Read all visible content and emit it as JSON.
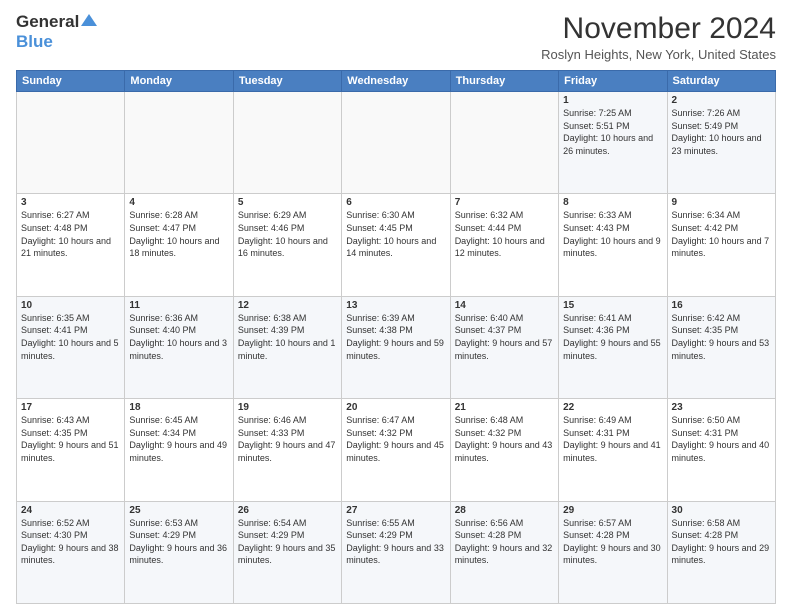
{
  "logo": {
    "general": "General",
    "blue": "Blue"
  },
  "title": "November 2024",
  "location": "Roslyn Heights, New York, United States",
  "weekdays": [
    "Sunday",
    "Monday",
    "Tuesday",
    "Wednesday",
    "Thursday",
    "Friday",
    "Saturday"
  ],
  "weeks": [
    [
      {
        "day": "",
        "info": ""
      },
      {
        "day": "",
        "info": ""
      },
      {
        "day": "",
        "info": ""
      },
      {
        "day": "",
        "info": ""
      },
      {
        "day": "",
        "info": ""
      },
      {
        "day": "1",
        "info": "Sunrise: 7:25 AM\nSunset: 5:51 PM\nDaylight: 10 hours and 26 minutes."
      },
      {
        "day": "2",
        "info": "Sunrise: 7:26 AM\nSunset: 5:49 PM\nDaylight: 10 hours and 23 minutes."
      }
    ],
    [
      {
        "day": "3",
        "info": "Sunrise: 6:27 AM\nSunset: 4:48 PM\nDaylight: 10 hours and 21 minutes."
      },
      {
        "day": "4",
        "info": "Sunrise: 6:28 AM\nSunset: 4:47 PM\nDaylight: 10 hours and 18 minutes."
      },
      {
        "day": "5",
        "info": "Sunrise: 6:29 AM\nSunset: 4:46 PM\nDaylight: 10 hours and 16 minutes."
      },
      {
        "day": "6",
        "info": "Sunrise: 6:30 AM\nSunset: 4:45 PM\nDaylight: 10 hours and 14 minutes."
      },
      {
        "day": "7",
        "info": "Sunrise: 6:32 AM\nSunset: 4:44 PM\nDaylight: 10 hours and 12 minutes."
      },
      {
        "day": "8",
        "info": "Sunrise: 6:33 AM\nSunset: 4:43 PM\nDaylight: 10 hours and 9 minutes."
      },
      {
        "day": "9",
        "info": "Sunrise: 6:34 AM\nSunset: 4:42 PM\nDaylight: 10 hours and 7 minutes."
      }
    ],
    [
      {
        "day": "10",
        "info": "Sunrise: 6:35 AM\nSunset: 4:41 PM\nDaylight: 10 hours and 5 minutes."
      },
      {
        "day": "11",
        "info": "Sunrise: 6:36 AM\nSunset: 4:40 PM\nDaylight: 10 hours and 3 minutes."
      },
      {
        "day": "12",
        "info": "Sunrise: 6:38 AM\nSunset: 4:39 PM\nDaylight: 10 hours and 1 minute."
      },
      {
        "day": "13",
        "info": "Sunrise: 6:39 AM\nSunset: 4:38 PM\nDaylight: 9 hours and 59 minutes."
      },
      {
        "day": "14",
        "info": "Sunrise: 6:40 AM\nSunset: 4:37 PM\nDaylight: 9 hours and 57 minutes."
      },
      {
        "day": "15",
        "info": "Sunrise: 6:41 AM\nSunset: 4:36 PM\nDaylight: 9 hours and 55 minutes."
      },
      {
        "day": "16",
        "info": "Sunrise: 6:42 AM\nSunset: 4:35 PM\nDaylight: 9 hours and 53 minutes."
      }
    ],
    [
      {
        "day": "17",
        "info": "Sunrise: 6:43 AM\nSunset: 4:35 PM\nDaylight: 9 hours and 51 minutes."
      },
      {
        "day": "18",
        "info": "Sunrise: 6:45 AM\nSunset: 4:34 PM\nDaylight: 9 hours and 49 minutes."
      },
      {
        "day": "19",
        "info": "Sunrise: 6:46 AM\nSunset: 4:33 PM\nDaylight: 9 hours and 47 minutes."
      },
      {
        "day": "20",
        "info": "Sunrise: 6:47 AM\nSunset: 4:32 PM\nDaylight: 9 hours and 45 minutes."
      },
      {
        "day": "21",
        "info": "Sunrise: 6:48 AM\nSunset: 4:32 PM\nDaylight: 9 hours and 43 minutes."
      },
      {
        "day": "22",
        "info": "Sunrise: 6:49 AM\nSunset: 4:31 PM\nDaylight: 9 hours and 41 minutes."
      },
      {
        "day": "23",
        "info": "Sunrise: 6:50 AM\nSunset: 4:31 PM\nDaylight: 9 hours and 40 minutes."
      }
    ],
    [
      {
        "day": "24",
        "info": "Sunrise: 6:52 AM\nSunset: 4:30 PM\nDaylight: 9 hours and 38 minutes."
      },
      {
        "day": "25",
        "info": "Sunrise: 6:53 AM\nSunset: 4:29 PM\nDaylight: 9 hours and 36 minutes."
      },
      {
        "day": "26",
        "info": "Sunrise: 6:54 AM\nSunset: 4:29 PM\nDaylight: 9 hours and 35 minutes."
      },
      {
        "day": "27",
        "info": "Sunrise: 6:55 AM\nSunset: 4:29 PM\nDaylight: 9 hours and 33 minutes."
      },
      {
        "day": "28",
        "info": "Sunrise: 6:56 AM\nSunset: 4:28 PM\nDaylight: 9 hours and 32 minutes."
      },
      {
        "day": "29",
        "info": "Sunrise: 6:57 AM\nSunset: 4:28 PM\nDaylight: 9 hours and 30 minutes."
      },
      {
        "day": "30",
        "info": "Sunrise: 6:58 AM\nSunset: 4:28 PM\nDaylight: 9 hours and 29 minutes."
      }
    ]
  ]
}
